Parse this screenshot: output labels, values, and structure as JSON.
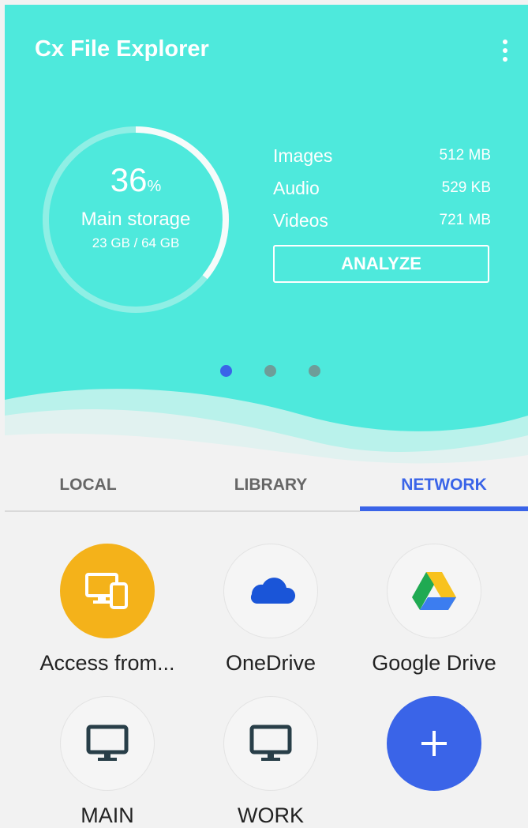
{
  "app": {
    "title": "Cx File Explorer"
  },
  "storage": {
    "percent_value": 36,
    "percent": "36",
    "percent_unit": "%",
    "label": "Main storage",
    "usage": "23 GB / 64 GB"
  },
  "stats": [
    {
      "label": "Images",
      "value": "512 MB"
    },
    {
      "label": "Audio",
      "value": "529  KB"
    },
    {
      "label": "Videos",
      "value": "721 MB"
    }
  ],
  "analyze_label": "ANALYZE",
  "pager": {
    "count": 3,
    "active_index": 0
  },
  "tabs": [
    {
      "label": "LOCAL",
      "active": false
    },
    {
      "label": "LIBRARY",
      "active": false
    },
    {
      "label": "NETWORK",
      "active": true
    }
  ],
  "network_items": [
    {
      "label": "Access from...",
      "icon": "devices-icon"
    },
    {
      "label": "OneDrive",
      "icon": "onedrive-icon"
    },
    {
      "label": "Google Drive",
      "icon": "google-drive-icon"
    },
    {
      "label": "MAIN",
      "icon": "monitor-icon"
    },
    {
      "label": "WORK",
      "icon": "monitor-icon"
    },
    {
      "label": "",
      "icon": "plus-icon"
    }
  ],
  "colors": {
    "header_bg": "#4ee9dc",
    "accent": "#3a64e8",
    "access_circle": "#f4b21a",
    "dot_active": "#3a64e8",
    "dot_inactive": "#6e9d99"
  }
}
